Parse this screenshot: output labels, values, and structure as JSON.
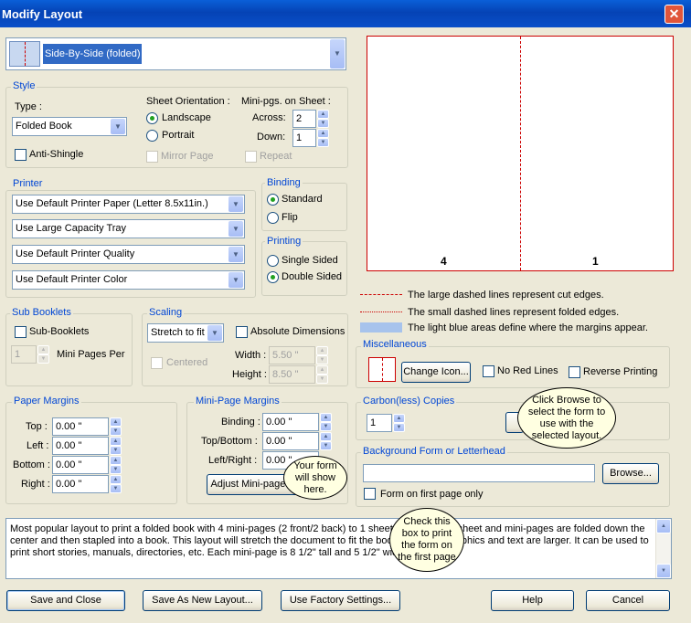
{
  "title": "Modify Layout",
  "layout_select": "Side-By-Side (folded)",
  "style": {
    "legend": "Style",
    "type_label": "Type :",
    "type_value": "Folded Book",
    "anti_shingle": "Anti-Shingle",
    "orientation_label": "Sheet Orientation :",
    "landscape": "Landscape",
    "portrait": "Portrait",
    "mirror": "Mirror Page",
    "minipgs_label": "Mini-pgs. on Sheet :",
    "across_label": "Across:",
    "across_value": "2",
    "down_label": "Down:",
    "down_value": "1",
    "repeat": "Repeat"
  },
  "printer": {
    "legend": "Printer",
    "paper": "Use Default Printer Paper (Letter 8.5x11in.)",
    "tray": "Use Large Capacity Tray",
    "quality": "Use Default Printer Quality",
    "color": "Use Default Printer Color"
  },
  "binding": {
    "legend": "Binding",
    "standard": "Standard",
    "flip": "Flip"
  },
  "printing": {
    "legend": "Printing",
    "single": "Single Sided",
    "double": "Double Sided"
  },
  "sub_booklets": {
    "legend": "Sub Booklets",
    "check": "Sub-Booklets",
    "value": "1",
    "mini_label": "Mini Pages Per"
  },
  "scaling": {
    "legend": "Scaling",
    "value": "Stretch to fit",
    "absolute": "Absolute Dimensions",
    "centered": "Centered",
    "width_label": "Width :",
    "width_value": "5.50 \"",
    "height_label": "Height :",
    "height_value": "8.50 \""
  },
  "paper_margins": {
    "legend": "Paper Margins",
    "top_label": "Top :",
    "top": "0.00 \"",
    "left_label": "Left :",
    "left": "0.00 \"",
    "bottom_label": "Bottom :",
    "bottom": "0.00 \"",
    "right_label": "Right :",
    "right": "0.00 \""
  },
  "mini_margins": {
    "legend": "Mini-Page Margins",
    "binding_label": "Binding :",
    "binding": "0.00 \"",
    "tb_label": "Top/Bottom :",
    "tb": "0.00 \"",
    "lr_label": "Left/Right :",
    "lr": "0.00 \"",
    "adjust": "Adjust Mini-page..."
  },
  "preview": {
    "page_left": "4",
    "page_right": "1"
  },
  "legend_items": {
    "cut": "The large dashed lines represent cut edges.",
    "fold": "The small dashed lines represent folded edges.",
    "margins": "The light blue areas define where the margins appear."
  },
  "misc": {
    "legend": "Miscellaneous",
    "change_icon": "Change Icon...",
    "no_red": "No Red Lines",
    "reverse": "Reverse Printing"
  },
  "carbon": {
    "legend": "Carbon(less) Copies",
    "value": "1"
  },
  "background": {
    "legend": "Background Form or Letterhead",
    "value": "",
    "browse": "Browse...",
    "first_page": "Form on first page only"
  },
  "callouts": {
    "browse": "Click Browse to select the form to use with the selected layout.",
    "form": "Your form will show here.",
    "check": "Check this box to print the form on the first page"
  },
  "description": "Most popular layout to print a folded book with 4 mini-pages (2 front/2 back) to 1 sheet of paper. The sheet and mini-pages are folded down the center and then stapled into a book.  This layout will stretch the document to fit the booklet so your graphics and text are larger.  It can be used to print short stories, manuals, directories, etc.  Each mini-page is 8 1/2\" tall and 5 1/2\" wide.",
  "buttons": {
    "save_close": "Save and Close",
    "save_new": "Save As New Layout...",
    "factory": "Use Factory Settings...",
    "help": "Help",
    "cancel": "Cancel"
  }
}
